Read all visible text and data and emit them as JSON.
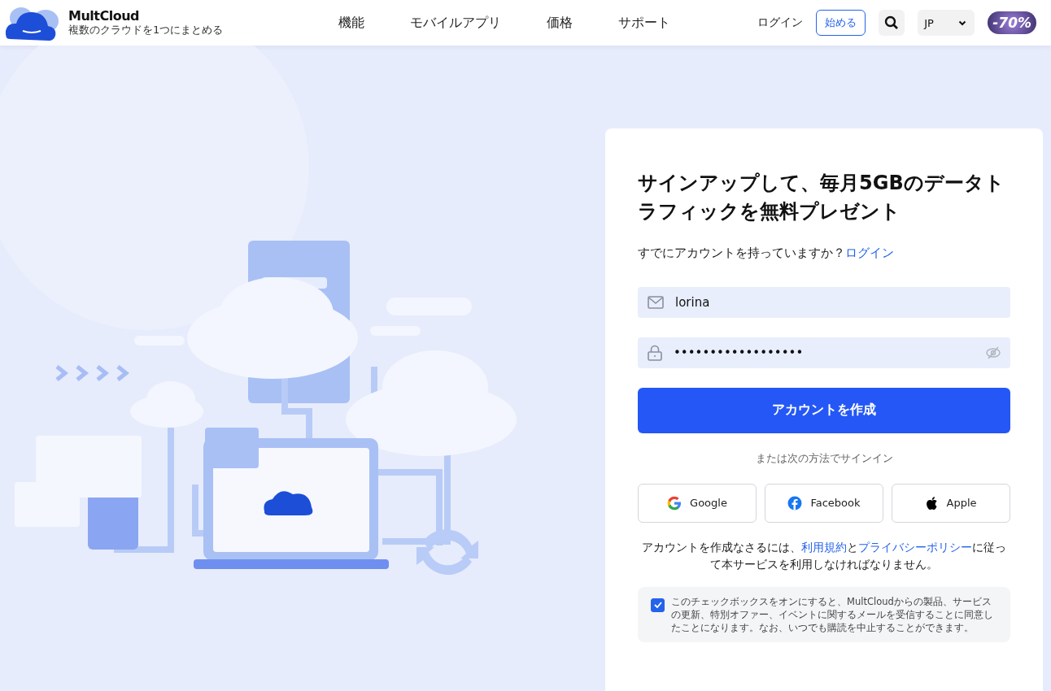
{
  "header": {
    "logo": {
      "name": "MultCloud",
      "tagline": "複数のクラウドを1つにまとめる"
    },
    "nav": [
      {
        "label": "機能"
      },
      {
        "label": "モバイルアプリ"
      },
      {
        "label": "価格"
      },
      {
        "label": "サポート"
      }
    ],
    "login": "ログイン",
    "start": "始める",
    "language": "JP",
    "promo_badge": "-70%"
  },
  "signup": {
    "title": "サインアップして、毎月5GBのデータトラフィックを無料プレゼント",
    "account_prompt": "すでにアカウントを持っていますか？",
    "login_link": "ログイン",
    "email": {
      "value": "lorina"
    },
    "password": {
      "value": "••••••••••••••••••"
    },
    "create_button": "アカウントを作成",
    "alt_signin": "または次の方法でサインイン",
    "providers": [
      {
        "kind": "google",
        "label": "Google"
      },
      {
        "kind": "facebook",
        "label": "Facebook"
      },
      {
        "kind": "apple",
        "label": "Apple"
      }
    ],
    "terms": {
      "before": "アカウントを作成なさるには、",
      "link1": "利用規約",
      "middle": "と",
      "link2": "プライバシーポリシー",
      "after": "に従って本サービスを利用しなければなりません。"
    },
    "consent": {
      "checked": true,
      "text": "このチェックボックスをオンにすると、MultCloudからの製品、サービスの更新、特別オファー、イベントに関するメールを受信することに同意したことになります。なお、いつでも購読を中止することができます。"
    }
  }
}
